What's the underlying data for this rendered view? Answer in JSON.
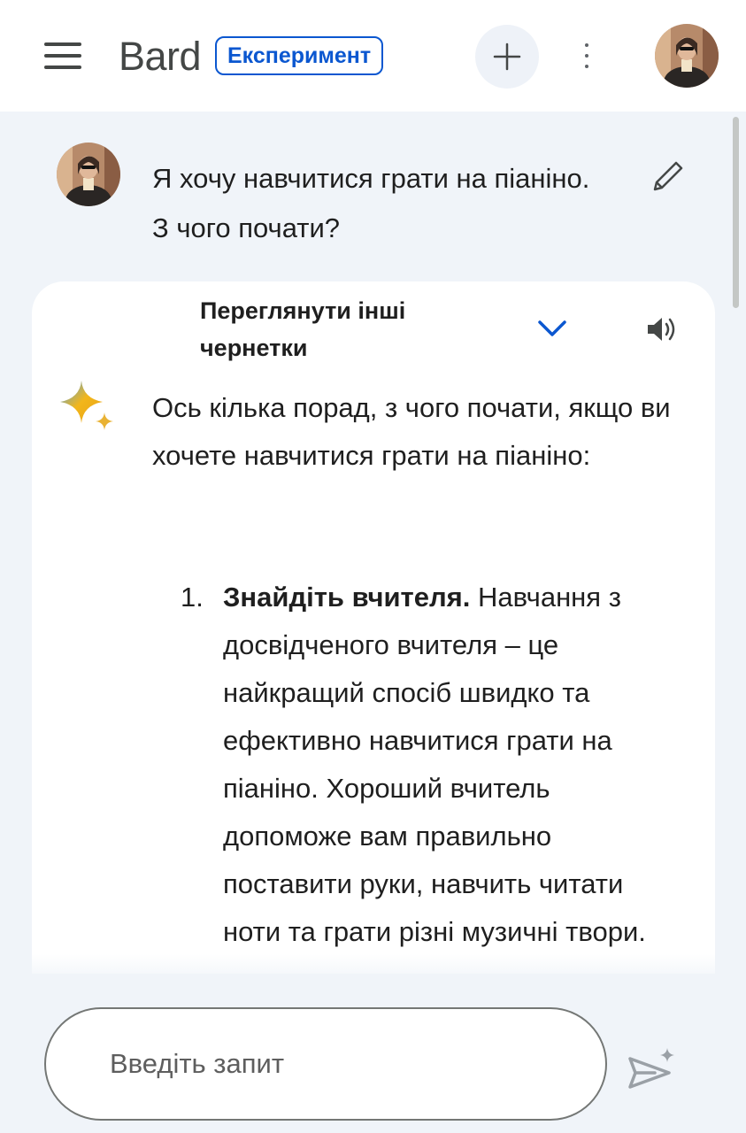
{
  "header": {
    "brand": "Bard",
    "badge": "Експеримент",
    "menu_icon": "hamburger-menu-icon",
    "new_chat_icon": "plus-icon",
    "more_icon": "more-vert-icon"
  },
  "conversation": {
    "user_prompt": "Я хочу навчитися грати на піаніно. З чого почати?",
    "edit_icon": "pencil-icon"
  },
  "response": {
    "drafts_label": "Переглянути інші чернетки",
    "intro": "Ось кілька порад, з чого почати, якщо ви хочете навчитися грати на піаніно:",
    "items": [
      {
        "number": "1.",
        "title": "Знайдіть вчителя.",
        "text": "Навчання з досвідченого вчителя – це найкращий спосіб швидко та ефективно навчитися грати на піаніно. Хороший вчитель допоможе вам правильно поставити руки, навчить читати ноти та грати різні музичні твори."
      }
    ]
  },
  "input": {
    "placeholder": "Введіть запит",
    "send_icon": "send-sparkle-icon"
  },
  "colors": {
    "accent": "#0b57d0",
    "background": "#f0f4f9",
    "card": "#ffffff"
  }
}
